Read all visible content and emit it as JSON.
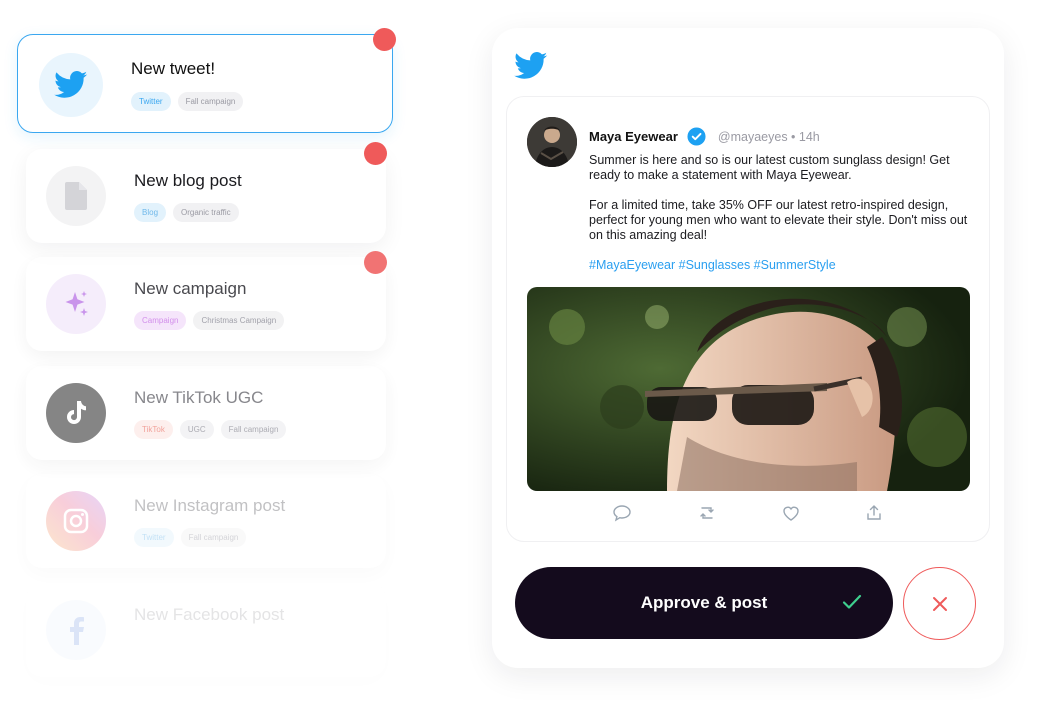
{
  "notifications": [
    {
      "title": "New tweet!",
      "tags": [
        "Twitter",
        "Fall campaign"
      ],
      "icon": "twitter-icon",
      "active": true,
      "unread": true
    },
    {
      "title": "New blog post",
      "tags": [
        "Blog",
        "Organic traffic"
      ],
      "icon": "document-icon",
      "unread": true
    },
    {
      "title": "New campaign",
      "tags": [
        "Campaign",
        "Christmas Campaign"
      ],
      "icon": "sparkles-icon",
      "unread": true
    },
    {
      "title": "New TikTok UGC",
      "tags": [
        "TikTok",
        "UGC",
        "Fall campaign"
      ],
      "icon": "tiktok-icon"
    },
    {
      "title": "New Instagram post",
      "tags": [
        "Twitter",
        "Fall campaign"
      ],
      "icon": "instagram-icon"
    },
    {
      "title": "New Facebook post",
      "tags": [],
      "icon": "facebook-icon"
    }
  ],
  "tweet": {
    "author": "Maya Eyewear",
    "handle": "@mayaeyes • 14h",
    "paragraphs": [
      "Summer is here and so is our latest custom sunglass design! Get ready to make a statement with Maya Eyewear.",
      "For a limited time, take 35% OFF our latest retro-inspired design, perfect for young men who want to elevate their style. Don't miss out on this amazing deal!"
    ],
    "hashtags": "#MayaEyewear #Sunglasses #SummerStyle"
  },
  "actions": {
    "approve_label": "Approve & post"
  },
  "colors": {
    "twitter_blue": "#1da1f2",
    "dark_button": "#140b1d",
    "alert_red": "#ef5a5a",
    "success_green": "#3ecf8e"
  }
}
